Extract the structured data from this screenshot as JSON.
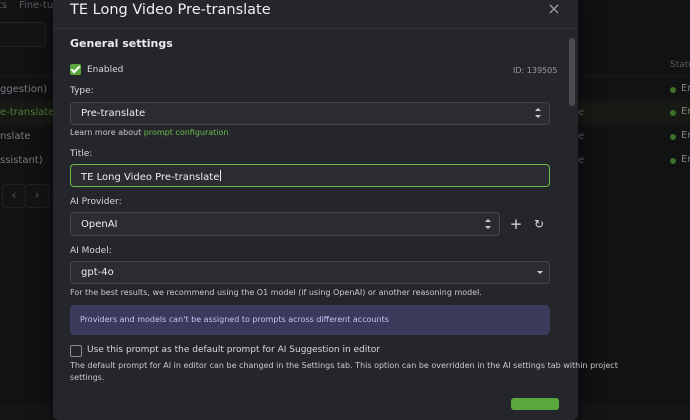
{
  "background": {
    "tabs": [
      "ts",
      "Fine-tun"
    ],
    "status_header": "Status",
    "rows": [
      {
        "left": "ggestion)",
        "mid": "",
        "status": "En"
      },
      {
        "left": "e-translate",
        "mid": "e",
        "status": "En",
        "selected": true
      },
      {
        "left": "nslate",
        "mid": "e",
        "status": "En"
      },
      {
        "left": "ssistant)",
        "mid": "e",
        "status": "En"
      }
    ],
    "pager": {
      "prev": "‹",
      "next": "›"
    }
  },
  "modal": {
    "title": "TE Long Video Pre-translate",
    "close_icon": "×",
    "section_title": "General settings",
    "enabled": {
      "label": "Enabled",
      "checked": true
    },
    "id_text": "ID: 139505",
    "type": {
      "label": "Type:",
      "value": "Pre-translate",
      "help_prefix": "Learn more about ",
      "help_link": "prompt configuration"
    },
    "title_field": {
      "label": "Title:",
      "value": "TE Long Video Pre-translate"
    },
    "ai_provider": {
      "label": "AI Provider:",
      "value": "OpenAI",
      "add_icon": "+",
      "refresh_icon": "↻"
    },
    "ai_model": {
      "label": "AI Model:",
      "value": "gpt-4o",
      "help": "For the best results, we recommend using the O1 model (if using OpenAI) or another reasoning model."
    },
    "info": "Providers and models can't be assigned to prompts across different accounts",
    "default_prompt": {
      "label": "Use this prompt as the default prompt for AI Suggestion in editor",
      "checked": false,
      "help_line1": "The default prompt for AI in editor can be changed in the Settings tab. This option can be overridden in the AI settings tab within project",
      "help_line2": "settings."
    }
  },
  "colors": {
    "accent": "#5aa83c",
    "link": "#6fba4a",
    "info_bg": "#3a3a5a"
  }
}
